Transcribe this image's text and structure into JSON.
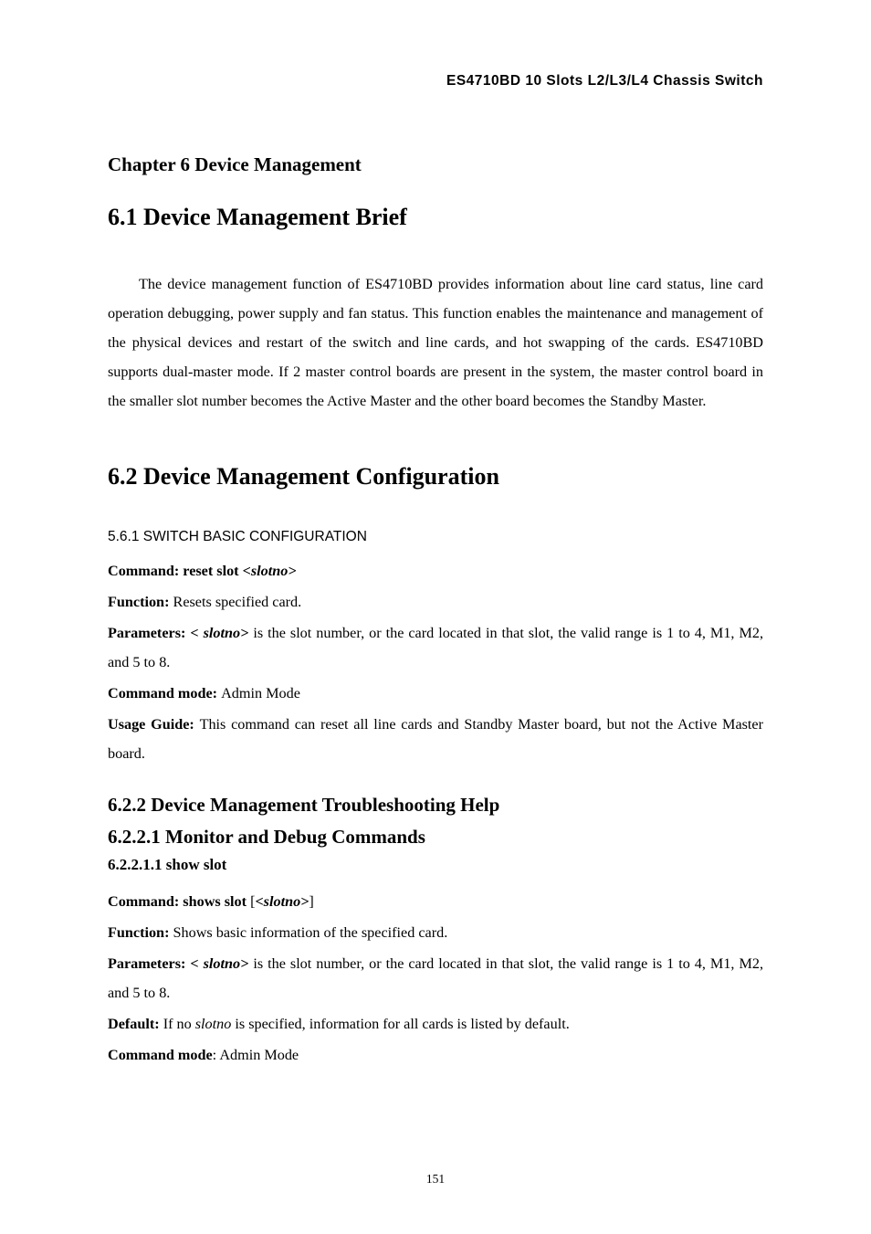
{
  "running_header": "ES4710BD 10 Slots L2/L3/L4 Chassis Switch",
  "chapter_title": "Chapter 6    Device Management",
  "section_6_1": {
    "heading": "6.1    Device Management Brief",
    "paragraph": "The device management function of ES4710BD provides information about line card status, line card operation debugging, power supply and fan status. This function enables the maintenance and management of the physical devices and restart of the switch and line cards, and hot swapping of the cards. ES4710BD supports dual-master mode. If 2 master control boards are present in the system, the master control board in the smaller slot number becomes the Active Master and the other board becomes the Standby Master."
  },
  "section_6_2": {
    "heading": "6.2    Device Management Configuration",
    "sub_561": "5.6.1 SWITCH BASIC CONFIGURATION",
    "cmd1": {
      "label": "Command: ",
      "text_prefix": "reset slot ",
      "param": "<slotno>"
    },
    "func1": {
      "label": "Function: ",
      "text": "Resets specified card."
    },
    "params1": {
      "label": "Parameters: ",
      "param": "< slotno>",
      "text": " is the slot number, or the card located in that slot, the valid range is 1 to 4, M1, M2, and 5 to 8."
    },
    "cmdmode1": {
      "label": "Command mode: ",
      "text": "Admin Mode"
    },
    "usage1": {
      "label": "Usage Guide: ",
      "text": "This command can reset all line cards and Standby Master board, but not the Active Master board."
    },
    "h_6_2_2": "6.2.2    Device Management Troubleshooting Help",
    "h_6_2_2_1": "6.2.2.1    Monitor and Debug Commands",
    "h_6_2_2_1_1": "6.2.2.1.1    show slot",
    "cmd2": {
      "label": "Command: ",
      "text_prefix": "shows slot ",
      "bracket_open": "[",
      "param": "<slotno>",
      "bracket_close": "]"
    },
    "func2": {
      "label": "Function: ",
      "text": "Shows basic information of the specified card."
    },
    "params2": {
      "label": "Parameters: ",
      "param": "< slotno>",
      "text": " is the slot number, or the card located in that slot, the valid range is 1 to 4, M1, M2, and 5 to 8."
    },
    "default2": {
      "label": "Default: ",
      "pre": "If no ",
      "em": "slotno",
      "post": " is specified, information for all cards is listed by default."
    },
    "cmdmode2": {
      "label": "Command mode",
      "text": ": Admin Mode"
    }
  },
  "page_number": "151"
}
